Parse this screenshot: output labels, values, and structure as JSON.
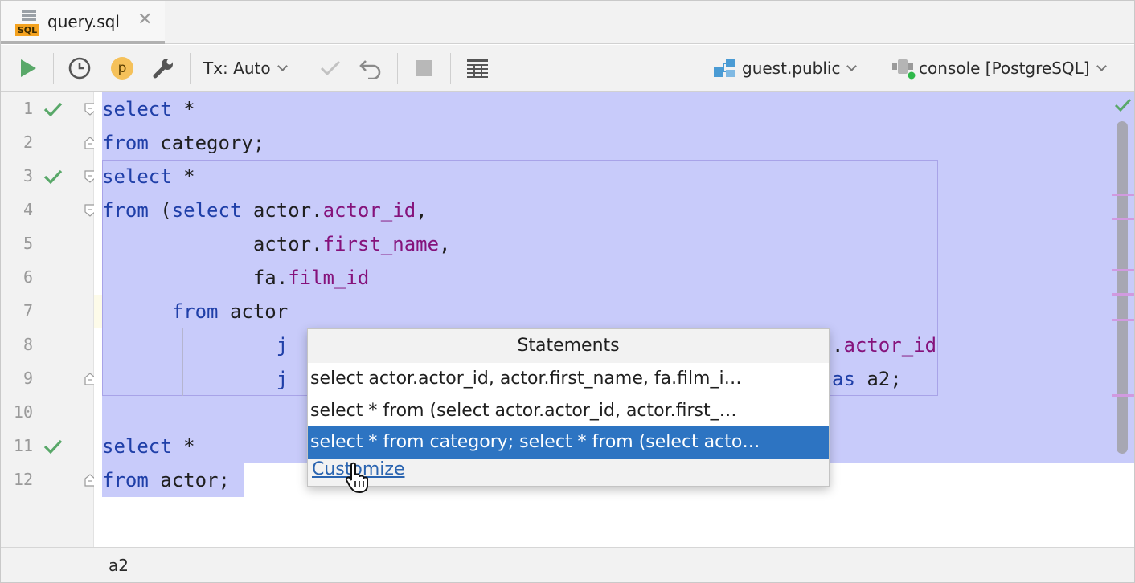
{
  "tab": {
    "title": "query.sql",
    "icon_label": "SQL"
  },
  "toolbar": {
    "tx_mode": "Tx: Auto",
    "profiler_letter": "p",
    "schema": "guest.public",
    "console": "console [PostgreSQL]"
  },
  "editor": {
    "line_numbers": [
      "1",
      "2",
      "3",
      "4",
      "5",
      "6",
      "7",
      "8",
      "9",
      "10",
      "11",
      "12"
    ],
    "lines": [
      [
        {
          "t": "select",
          "c": "kw"
        },
        {
          "t": " *",
          "c": ""
        }
      ],
      [
        {
          "t": "from",
          "c": "kw"
        },
        {
          "t": " category;",
          "c": ""
        }
      ],
      [
        {
          "t": "select",
          "c": "kw"
        },
        {
          "t": " *",
          "c": ""
        }
      ],
      [
        {
          "t": "from",
          "c": "kw"
        },
        {
          "t": " (",
          "c": ""
        },
        {
          "t": "select",
          "c": "kw"
        },
        {
          "t": " actor.",
          "c": ""
        },
        {
          "t": "actor_id",
          "c": "fld"
        },
        {
          "t": ",",
          "c": ""
        }
      ],
      [
        {
          "t": "             actor.",
          "c": ""
        },
        {
          "t": "first_name",
          "c": "fld"
        },
        {
          "t": ",",
          "c": ""
        }
      ],
      [
        {
          "t": "             fa.",
          "c": ""
        },
        {
          "t": "film_id",
          "c": "fld"
        }
      ],
      [
        {
          "t": "      ",
          "c": ""
        },
        {
          "t": "from",
          "c": "kw"
        },
        {
          "t": " actor",
          "c": ""
        }
      ],
      [
        {
          "t": "               ",
          "c": ""
        },
        {
          "t": "j",
          "c": "kw"
        }
      ],
      [
        {
          "t": "               ",
          "c": ""
        },
        {
          "t": "j",
          "c": "kw"
        }
      ],
      [],
      [
        {
          "t": "select",
          "c": "kw"
        },
        {
          "t": " *",
          "c": ""
        }
      ],
      [
        {
          "t": "from",
          "c": "kw"
        },
        {
          "t": " actor;",
          "c": ""
        }
      ]
    ],
    "line8_tail": [
      {
        "t": ".",
        "c": ""
      },
      {
        "t": "actor_id",
        "c": "fld"
      }
    ],
    "line9_tail": [
      {
        "t": "as",
        "c": "kw"
      },
      {
        "t": " a2;",
        "c": ""
      }
    ]
  },
  "popup": {
    "title": "Statements",
    "items": [
      "select actor.actor_id, actor.first_name, fa.film_i…",
      "select * from (select actor.actor_id, actor.first_…",
      "select * from category; select * from (select acto…"
    ],
    "selected_index": 2,
    "customize_label": "Customize"
  },
  "statusbar": {
    "breadcrumb": "a2"
  },
  "colors": {
    "selection": "#c8cbfa",
    "keyword": "#1f3fa8",
    "field": "#85127b",
    "popup_selected": "#2d74c2",
    "check": "#59a869"
  }
}
